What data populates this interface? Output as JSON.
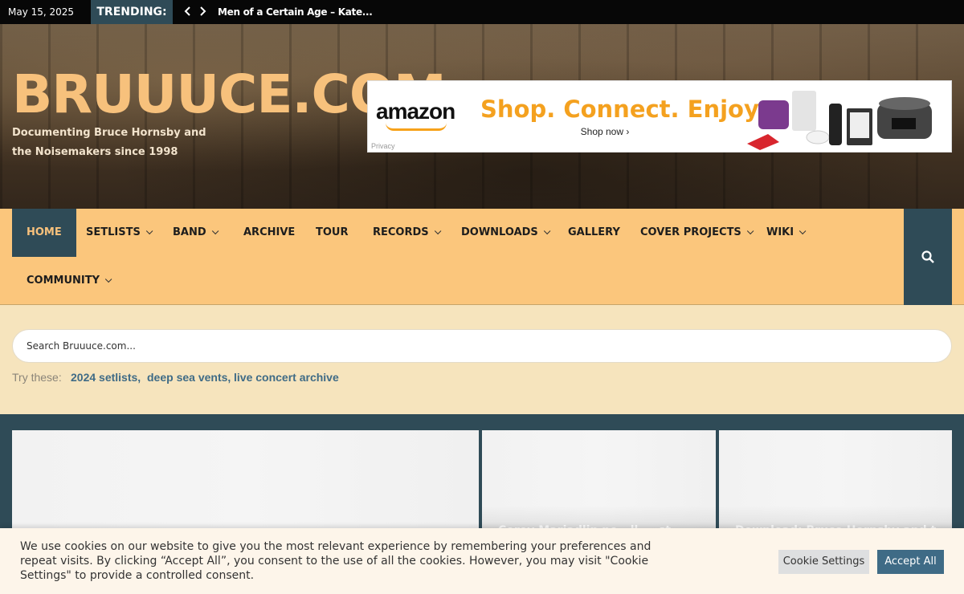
{
  "topbar": {
    "date": "May 15, 2025",
    "trending_label": "TRENDING:",
    "prev_icon": "chevron-left-icon",
    "next_icon": "chevron-right-icon",
    "headline": "Men of a Certain Age – Kate..."
  },
  "header": {
    "site_title": "BRUUUCE.COM",
    "tagline": "Documenting Bruce Hornsby and the Noisemakers since 1998",
    "ad": {
      "brand": "amazon",
      "headline": "Shop. Connect. Enjoy.",
      "cta": "Shop now ›",
      "privacy": "Privacy"
    }
  },
  "nav": {
    "items": [
      {
        "label": "HOME",
        "active": true,
        "dropdown": false
      },
      {
        "label": "SETLISTS",
        "dropdown": true
      },
      {
        "label": "BAND",
        "dropdown": true
      },
      {
        "label": "ARCHIVE",
        "dropdown": false
      },
      {
        "label": "TOUR",
        "dropdown": false
      },
      {
        "label": "RECORDS",
        "dropdown": true
      },
      {
        "label": "DOWNLOADS",
        "dropdown": true
      },
      {
        "label": "GALLERY",
        "dropdown": false
      },
      {
        "label": "COVER PROJECTS",
        "dropdown": true
      },
      {
        "label": "WIKI",
        "dropdown": true
      },
      {
        "label": "COMMUNITY",
        "dropdown": true
      }
    ],
    "search_icon": "search-icon"
  },
  "search": {
    "placeholder": "Search Bruuuce.com...",
    "try_label": "Try these:",
    "suggestions": [
      "2024 setlists,",
      "deep sea vents,",
      "live concert archive"
    ]
  },
  "cards": [
    {
      "title": ""
    },
    {
      "title": "Corey Mariadlin ne...ll ... st"
    },
    {
      "title": "Download: Bruce Hornsby and th..."
    }
  ],
  "cookie": {
    "text": "We use cookies on our website to give you the most relevant experience by remembering your preferences and repeat visits. By clicking “Accept All”, you consent to the use of all the cookies. However, you may visit \"Cookie Settings\" to provide a controlled consent.",
    "settings_label": "Cookie Settings",
    "accept_label": "Accept All"
  },
  "colors": {
    "brand_orange": "#f7c17c",
    "nav_bg": "#fbc67c",
    "teal": "#2f4b57",
    "link_blue": "#3f6b86"
  }
}
